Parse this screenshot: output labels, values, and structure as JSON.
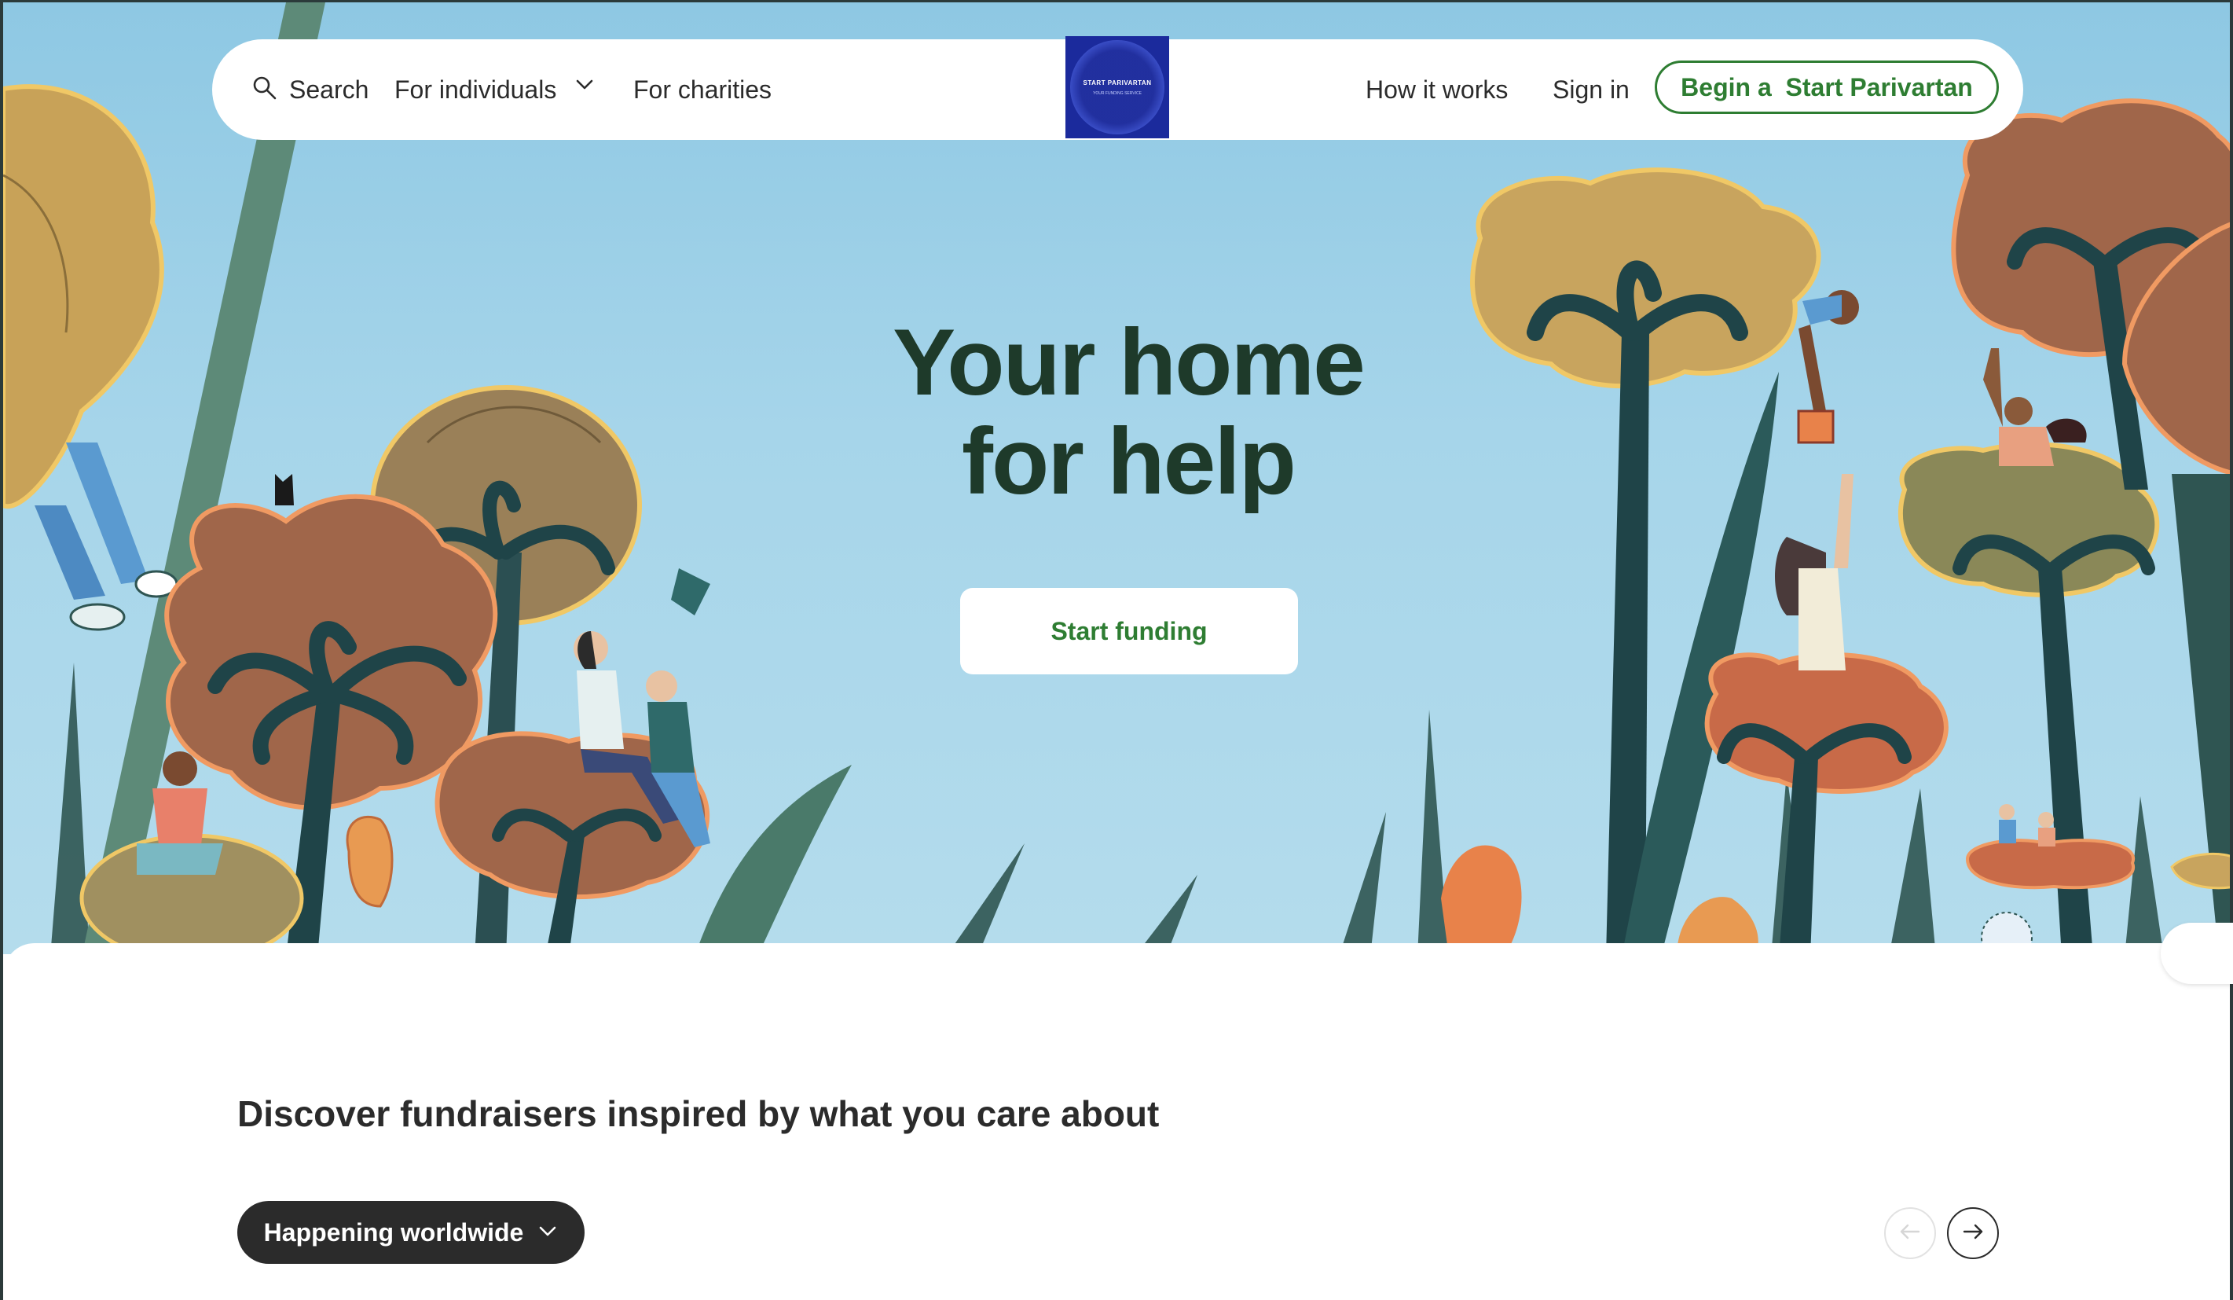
{
  "nav": {
    "search_label": "Search",
    "individuals_label": "For individuals",
    "charities_label": "For charities",
    "logo_title": "START PARIVARTAN",
    "logo_subtitle": "YOUR FUNDING SERVICE",
    "how_label": "How it works",
    "signin_label": "Sign in",
    "begin_label": "Begin a  Start Parivartan"
  },
  "hero": {
    "headline_line1": "Your home",
    "headline_line2": "for help",
    "cta_label": "Start funding"
  },
  "discover": {
    "title": "Discover fundraisers inspired by what you care about",
    "filter_label": "Happening worldwide"
  },
  "icons": {
    "search": "search-icon",
    "chevron": "chevron-down-icon",
    "prev": "arrow-left-icon",
    "next": "arrow-right-icon"
  },
  "colors": {
    "accent_green": "#2e7d32",
    "headline_green": "#1e3a2a",
    "sky": "#a6d5ea",
    "pill_dark": "#2b2b2b",
    "logo_blue": "#1b2a9c"
  }
}
